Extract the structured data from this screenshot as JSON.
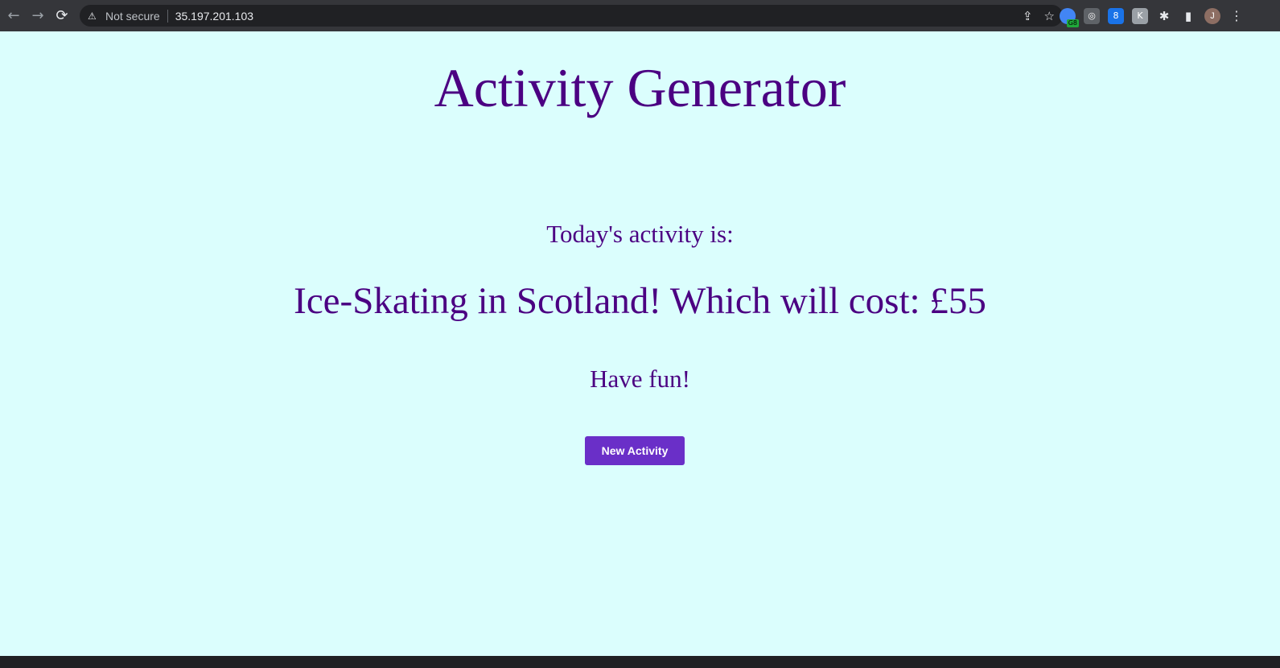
{
  "browser": {
    "back_icon": "←",
    "forward_icon": "→",
    "reload_icon": "⟳",
    "security_icon": "warning-triangle",
    "security_text": "Not secure",
    "url": "35.197.201.103",
    "share_icon": "⇪",
    "star_icon": "☆",
    "extensions": [
      {
        "name": "chrome-ext-badge",
        "glyph": "●",
        "badge": "G8",
        "color": "#4285f4"
      },
      {
        "name": "glasses-ext",
        "glyph": "◎",
        "color": "#9aa0a6"
      },
      {
        "name": "number-ext",
        "glyph": "8",
        "color": "#1a73e8"
      },
      {
        "name": "gray-ext",
        "glyph": "K",
        "color": "#9aa0a6"
      }
    ],
    "puzzle_icon": "✱",
    "sidepanel_icon": "▮",
    "avatar_initial": "J",
    "menu_icon": "⋮"
  },
  "page": {
    "title": "Activity Generator",
    "prompt": "Today's activity is:",
    "activity": "Ice-Skating in Scotland! Which will cost: £55",
    "closing": "Have fun!",
    "button_label": "New Activity",
    "colors": {
      "background": "#dbfefd",
      "text": "#4b0082",
      "button": "#6a2fc8"
    }
  }
}
